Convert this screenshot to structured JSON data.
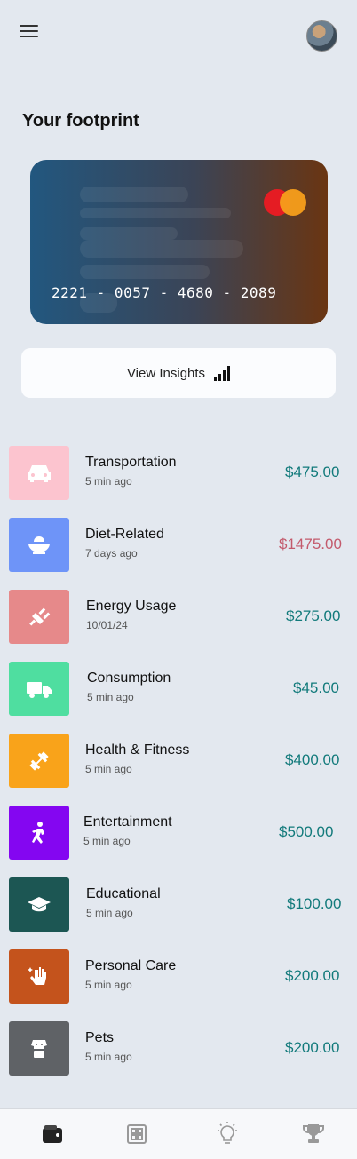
{
  "page": {
    "title": "Your footprint"
  },
  "card": {
    "number": "2221 - 0057 - 4680 - 2089",
    "brand_icon": "mastercard-logo"
  },
  "insights": {
    "label": "View Insights",
    "icon": "signal-bars-icon"
  },
  "items": [
    {
      "label": "Transportation",
      "time": "5 min ago",
      "amount": "$475.00",
      "color": "#fcc4cf",
      "amount_color": "#127a7b",
      "icon": "car-icon"
    },
    {
      "label": "Diet-Related",
      "time": "7 days ago",
      "amount": "$1475.00",
      "color": "#6e94f8",
      "amount_color": "#c35a6c",
      "icon": "food-bowl-icon"
    },
    {
      "label": "Energy Usage",
      "time": "10/01/24",
      "amount": "$275.00",
      "color": "#e6898a",
      "amount_color": "#127a7b",
      "icon": "plug-icon"
    },
    {
      "label": "Consumption",
      "time": "5 min ago",
      "amount": "$45.00",
      "color": "#4fdea0",
      "amount_color": "#127a7b",
      "icon": "truck-icon"
    },
    {
      "label": "Health & Fitness",
      "time": "5 min ago",
      "amount": "$400.00",
      "color": "#f9a31a",
      "amount_color": "#127a7b",
      "icon": "dumbbell-icon"
    },
    {
      "label": "Entertainment",
      "time": "5 min ago",
      "amount": "$500.00",
      "color": "#8406f1",
      "amount_color": "#127a7b",
      "icon": "dancing-person-icon"
    },
    {
      "label": "Educational",
      "time": "5 min ago",
      "amount": "$100.00",
      "color": "#1c5653",
      "amount_color": "#127a7b",
      "icon": "graduation-cap-icon"
    },
    {
      "label": "Personal Care",
      "time": "5 min ago",
      "amount": "$200.00",
      "color": "#c4531c",
      "amount_color": "#127a7b",
      "icon": "hand-sparkle-icon"
    },
    {
      "label": "Pets",
      "time": "5 min ago",
      "amount": "$200.00",
      "color": "#5f6266",
      "amount_color": "#127a7b",
      "icon": "dog-icon"
    }
  ],
  "nav": [
    {
      "name": "wallet-icon",
      "active": true
    },
    {
      "name": "grid-icon",
      "active": false
    },
    {
      "name": "lightbulb-icon",
      "active": false
    },
    {
      "name": "trophy-icon",
      "active": false
    }
  ]
}
